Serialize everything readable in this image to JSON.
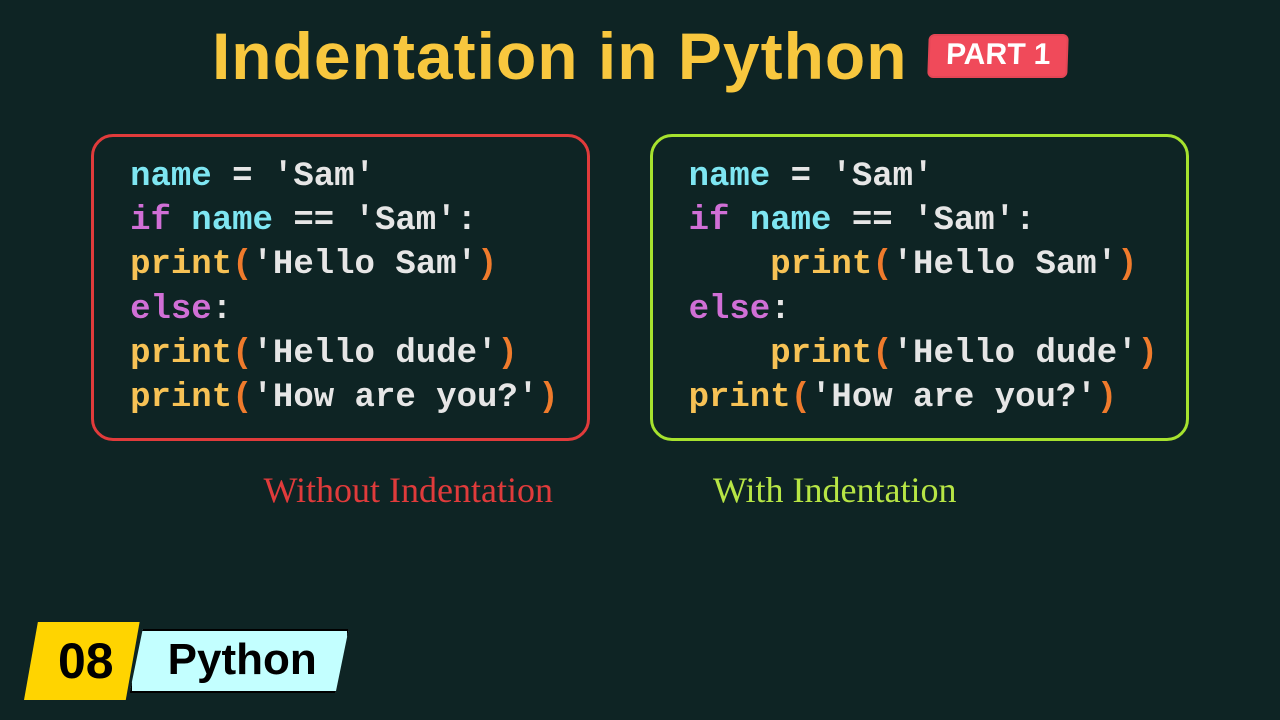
{
  "title": "Indentation in Python",
  "part": "PART 1",
  "left_caption": "Without Indentation",
  "right_caption": "With Indentation",
  "lesson_number": "08",
  "language": "Python",
  "code_left": {
    "l1_var": "name",
    "l1_op": " = ",
    "l1_str": "'Sam'",
    "l2_kw": "if",
    "l2_var": " name ",
    "l2_op": "== ",
    "l2_str": "'Sam'",
    "l2_col": ":",
    "l3_func": "print",
    "l3_po": "(",
    "l3_str": "'Hello Sam'",
    "l3_pc": ")",
    "l4_kw": "else",
    "l4_col": ":",
    "l5_func": "print",
    "l5_po": "(",
    "l5_str": "'Hello dude'",
    "l5_pc": ")",
    "l6_func": "print",
    "l6_po": "(",
    "l6_str": "'How are you?'",
    "l6_pc": ")"
  },
  "code_right": {
    "l1_var": "name",
    "l1_op": " = ",
    "l1_str": "'Sam'",
    "l2_kw": "if",
    "l2_var": " name ",
    "l2_op": "== ",
    "l2_str": "'Sam'",
    "l2_col": ":",
    "l3_indent": "    ",
    "l3_func": "print",
    "l3_po": "(",
    "l3_str": "'Hello Sam'",
    "l3_pc": ")",
    "l4_kw": "else",
    "l4_col": ":",
    "l5_indent": "    ",
    "l5_func": "print",
    "l5_po": "(",
    "l5_str": "'Hello dude'",
    "l5_pc": ")",
    "l6_func": "print",
    "l6_po": "(",
    "l6_str": "'How are you?'",
    "l6_pc": ")"
  }
}
